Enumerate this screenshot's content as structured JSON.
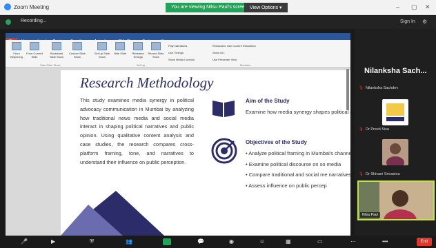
{
  "window": {
    "title": "Zoom Meeting",
    "minimize": "–",
    "maximize": "▢",
    "close": "✕"
  },
  "banner": {
    "text": "You are viewing Nitsu Paul's screen",
    "view_options": "View Options ▾"
  },
  "zoom_top": {
    "recording": "Recording...",
    "sign_in": "Sign In"
  },
  "ribbon": {
    "tabs": [
      "File",
      "Home",
      "Insert",
      "Design",
      "Transitions",
      "Animations",
      "Slide Show",
      "Review",
      "View"
    ],
    "buttons": [
      "From Beginning",
      "From Current Slide",
      "Broadcast Slide Show",
      "Custom Slide Show",
      "Set Up Slide Show",
      "Hide Slide",
      "Rehearse Timings",
      "Record Slide Show"
    ],
    "options": [
      "Play Narrations",
      "Use Timings",
      "Show Media Controls"
    ],
    "monitor": [
      "Resolution: Use Current Resolution",
      "Show On:",
      "Use Presenter View"
    ],
    "groups": [
      "Start Slide Show",
      "Set Up",
      "Monitors"
    ]
  },
  "slide": {
    "title": "Research Methodology",
    "body": "This study examines media synergy in political advocacy communication in Mumbai by analyzing how traditional news media and social media interact in shaping political narratives and public opinion. Using qualitative content analysis and case studies, the research compares cross-platform framing, tone, and narratives to understand their influence on public perception.",
    "aim_title": "Aim of the Study",
    "aim_text": "Examine how media synergy shapes political advocacy communication in Mumbai",
    "objectives_title": "Objectives of the Study",
    "objectives": [
      "• Analyze political framing in Mumbai's channels",
      "• Examine political discourse on so media",
      "• Compare traditional and social me narratives",
      "• Assess influence on public percep"
    ]
  },
  "participants": {
    "speaker": "Nilanksha Sach...",
    "items": [
      "Nilanksha Sachdev",
      "Dr Preeti Sisa",
      "Dr Shivani Srivastva"
    ],
    "video_name": "Nitsu Paul"
  },
  "toolbar": {
    "end": "End"
  },
  "colors": {
    "accent": "#2c2c6a",
    "banner_green": "#23a35a",
    "end_red": "#e0362c",
    "ribbon_blue": "#2b579a",
    "active_speaker": "#c3e34a"
  }
}
